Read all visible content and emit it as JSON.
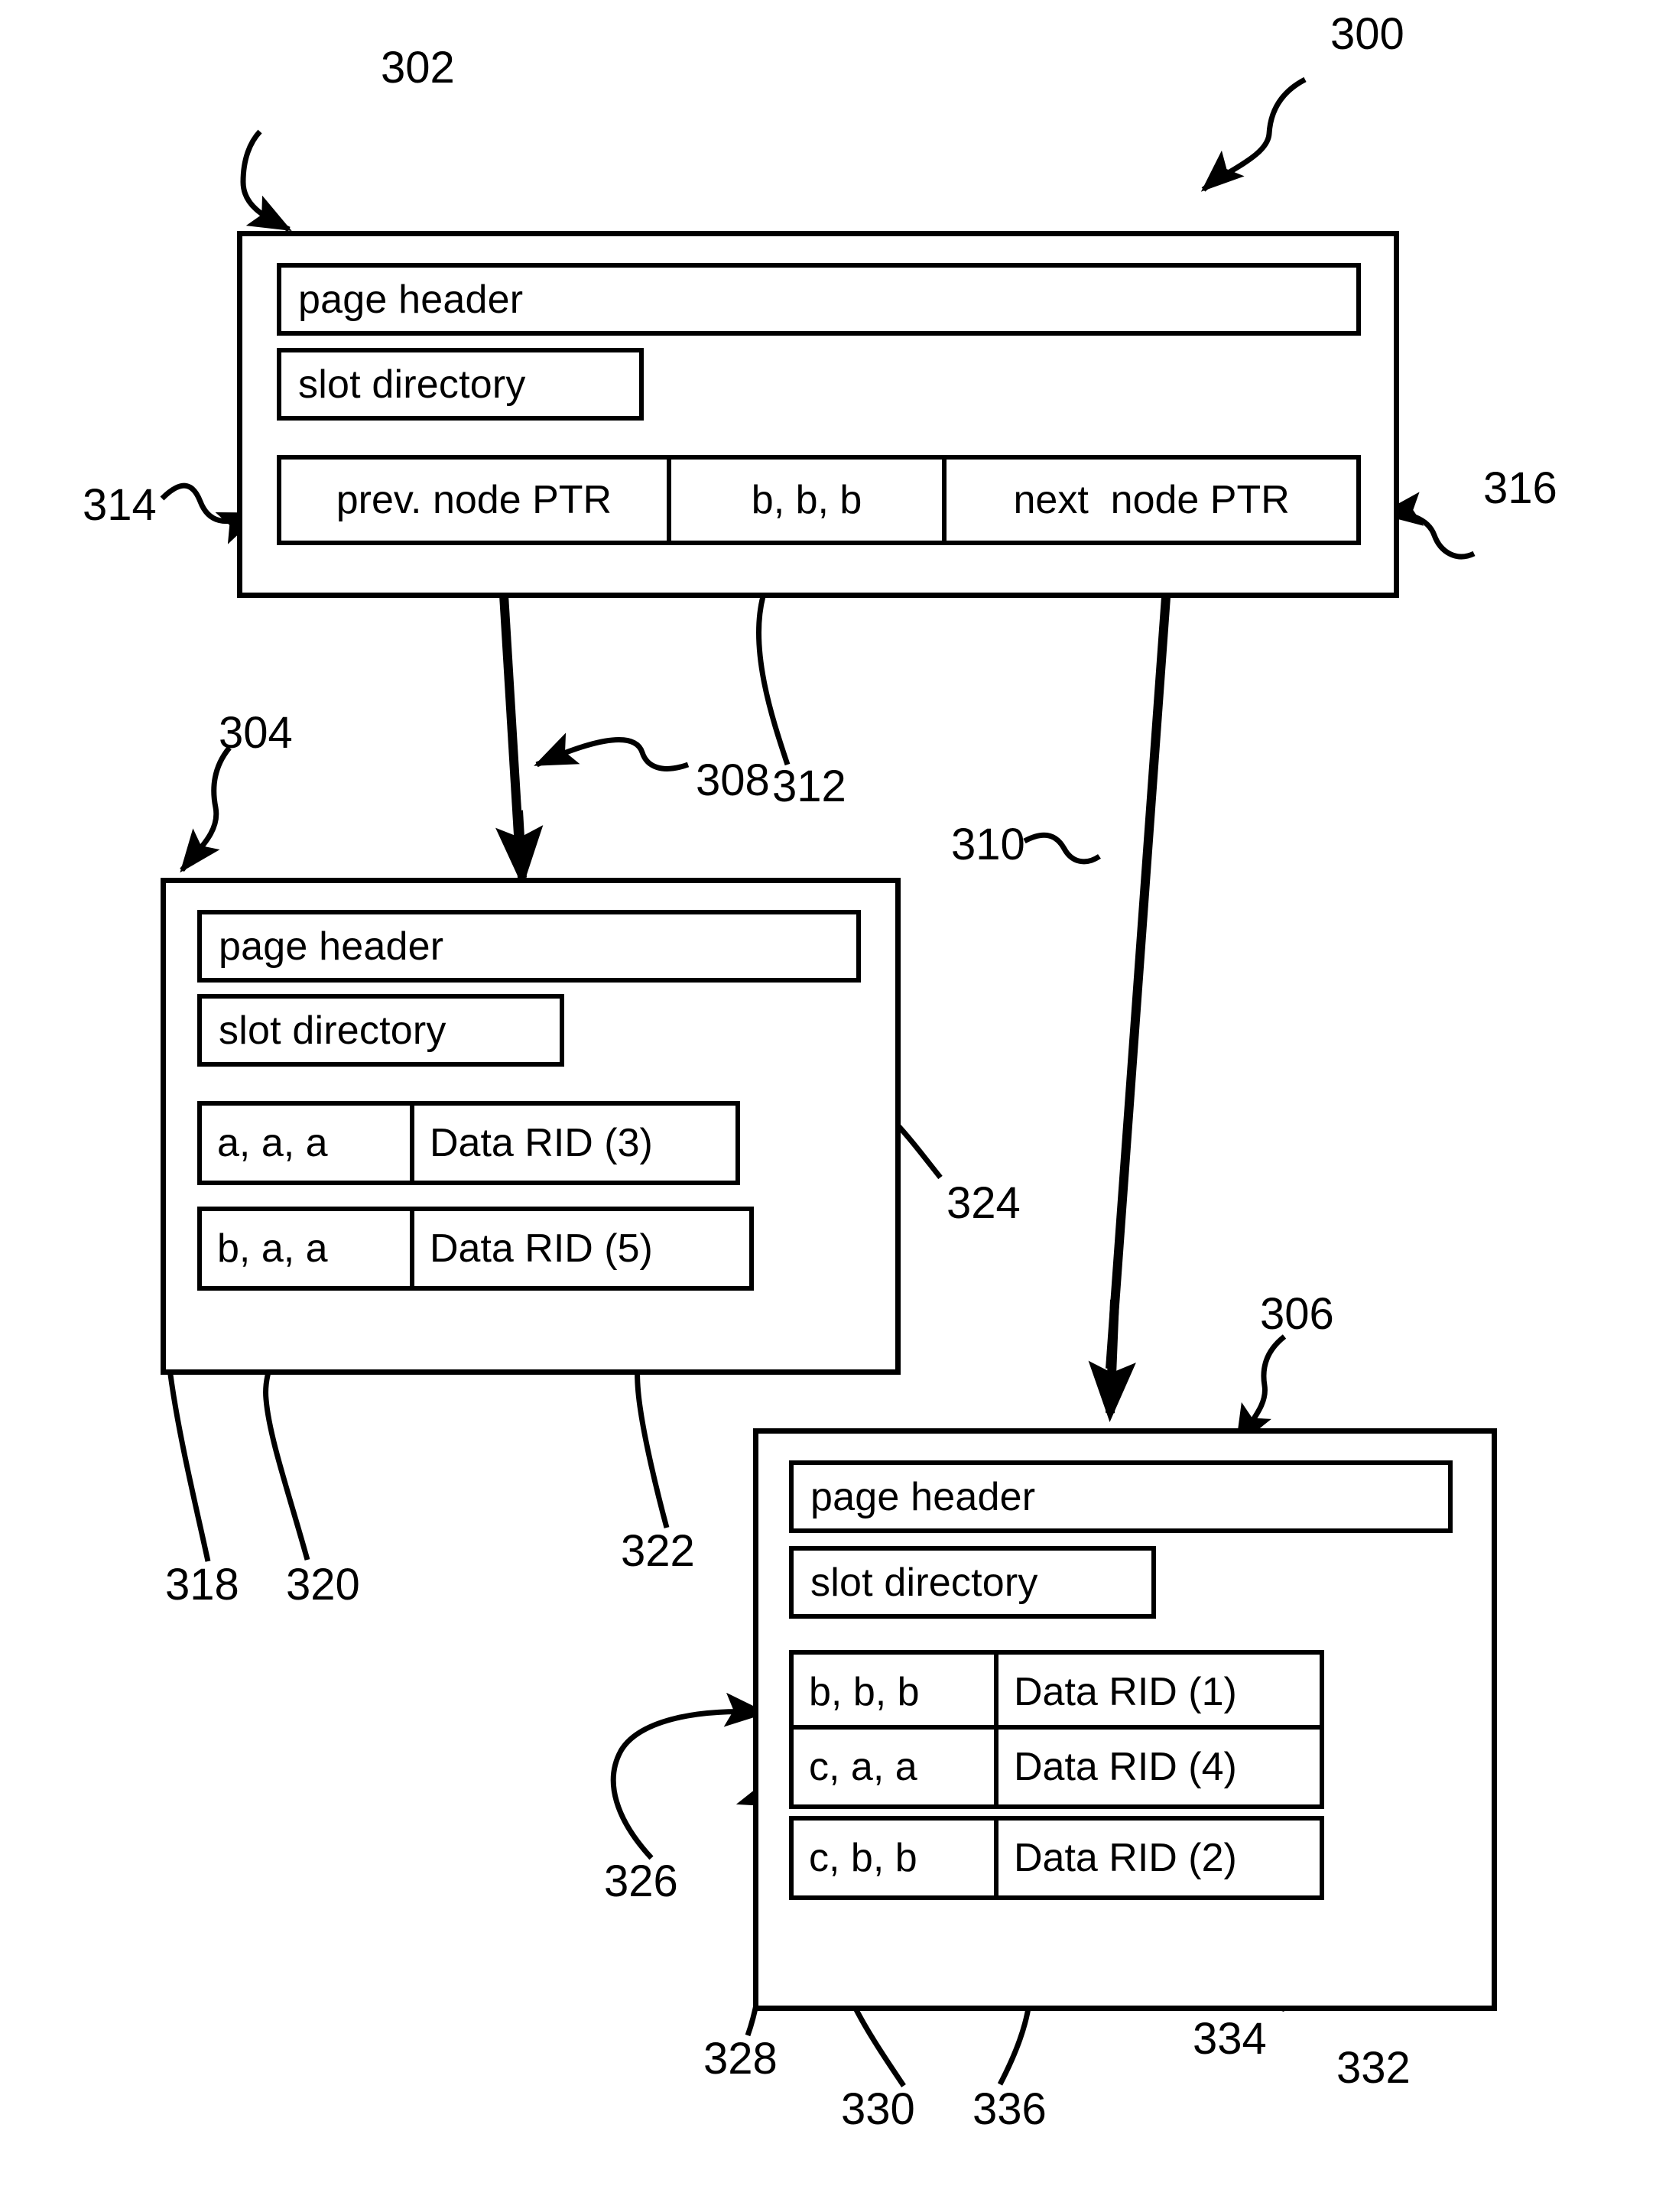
{
  "figure": {
    "id": "300",
    "type": "patent-diagram",
    "title": ""
  },
  "labels": {
    "page_header": "page header",
    "slot_directory": "slot directory",
    "prev_node_ptr": "prev. node PTR",
    "next_node_ptr": "next  node PTR"
  },
  "refs": {
    "r300": "300",
    "r302": "302",
    "r304": "304",
    "r306": "306",
    "r308": "308",
    "r310": "310",
    "r312": "312",
    "r314": "314",
    "r316": "316",
    "r318": "318",
    "r320": "320",
    "r322": "322",
    "r324": "324",
    "r326": "326",
    "r328": "328",
    "r330": "330",
    "r332": "332",
    "r334": "334",
    "r336": "336"
  },
  "nodes": {
    "root": {
      "ref": "302",
      "header": "page header",
      "slot_directory": "slot directory",
      "ptr_row": {
        "prev": "prev. node PTR",
        "key": "b, b, b",
        "next": "next  node PTR"
      }
    },
    "left_leaf": {
      "ref": "304",
      "header": "page header",
      "slot_directory": "slot directory",
      "records": [
        {
          "key": "a, a, a",
          "value": "Data RID (3)"
        },
        {
          "key": "b, a, a",
          "value": "Data RID (5)"
        }
      ]
    },
    "right_leaf": {
      "ref": "306",
      "header": "page header",
      "slot_directory": "slot directory",
      "records": [
        {
          "key": "b, b, b",
          "value": "Data RID (1)"
        },
        {
          "key": "c, a, a",
          "value": "Data RID (4)"
        },
        {
          "key": "c, b, b",
          "value": "Data RID (2)"
        }
      ]
    }
  },
  "colors": {
    "ink": "#000000",
    "paper": "#ffffff"
  }
}
